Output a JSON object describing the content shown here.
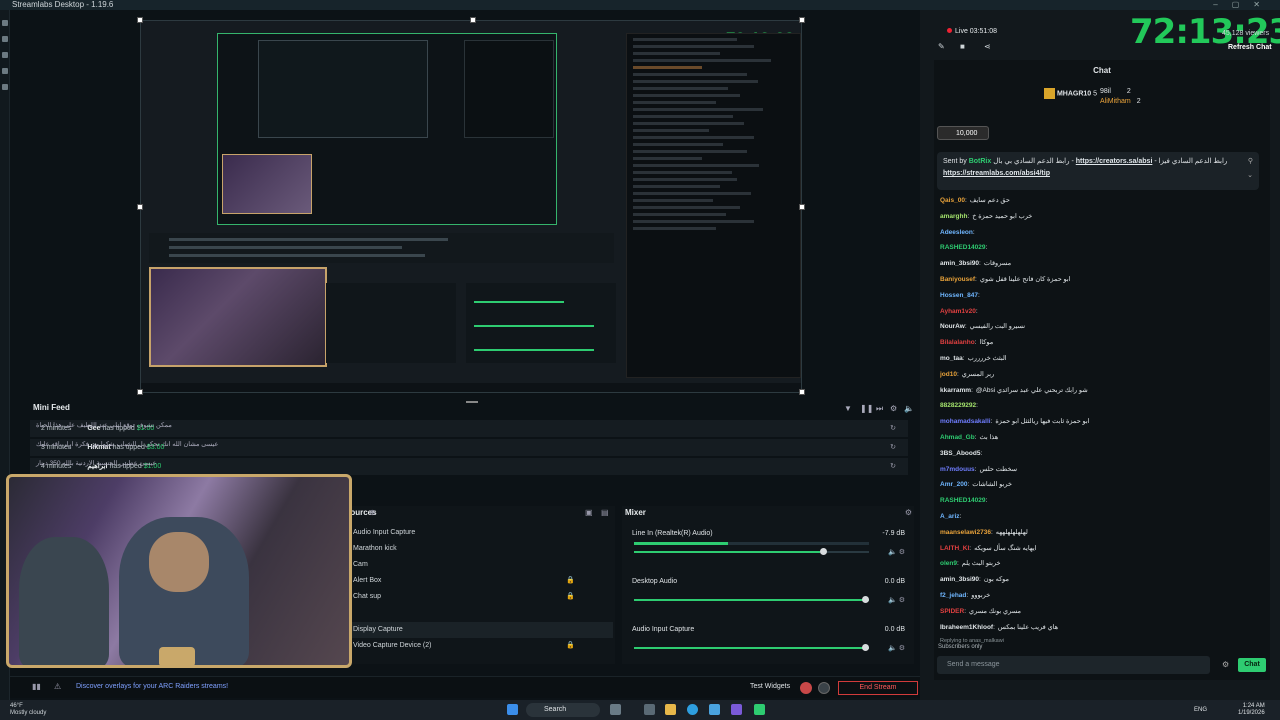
{
  "app": {
    "title": "Streamlabs Desktop - 1.19.6"
  },
  "preview": {
    "clock": "72:13:23"
  },
  "mini_feed": {
    "title": "Mini Feed",
    "rows": [
      {
        "time": "2 minutes",
        "name": "Gee",
        "action": "has tipped",
        "amount": "$1.00",
        "message": "ممكن تشوف توقع ليلى عبد اللطيف على هذا الحياة"
      },
      {
        "time": "3 minutes",
        "name": "Hikmat",
        "action": "has tipped",
        "amount": "$3.00",
        "message": "عيسى مشان الله انك تحكي ل الشباب يفكوا من فكرة ارار باقه عليك"
      },
      {
        "time": "4 minutes",
        "name": "ابراهيم",
        "action": "has tipped",
        "amount": "$1.00",
        "message": "عيسى عطيني الجنسية الاردنية بالله 350 دينار"
      }
    ]
  },
  "sources": {
    "title": "Sources",
    "items": [
      "Audio Input Capture",
      "Marathon kick",
      "Cam",
      "Alert Box",
      "Chat sup",
      "",
      "Display Capture",
      "Video Capture Device (2)"
    ]
  },
  "mixer": {
    "title": "Mixer",
    "channels": [
      {
        "name": "Line In (Realtek(R) Audio)",
        "db": "-7.9 dB",
        "level": 0.85
      },
      {
        "name": "Desktop Audio",
        "db": "0.0 dB",
        "level": 1.0
      },
      {
        "name": "Audio Input Capture",
        "db": "0.0 dB",
        "level": 1.0
      }
    ]
  },
  "footer": {
    "promo": "Discover overlays for your ARC Raiders streams!",
    "test_widgets": "Test Widgets",
    "end_stream": "End Stream"
  },
  "stream": {
    "live": "Live 03:51:08",
    "clock": "72:13:23",
    "viewers": "45,128 viewers",
    "refresh": "Refresh Chat"
  },
  "chat": {
    "title": "Chat",
    "leaders": [
      {
        "name": "MHAGR10",
        "value": "5"
      },
      {
        "name": "98il",
        "value": "2"
      },
      {
        "name": "AliMitham",
        "value": "2"
      }
    ],
    "tip_amount": "10,000",
    "pinned": {
      "sent_by": "Sent by",
      "bot": "BotRix",
      "text": "رابط الدعم السادي بي بال -",
      "link1": "https://creators.sa/absi",
      "text2": "- رابط الدعم السادي فيزا",
      "link2": "https://streamlabs.com/absi4/tip"
    },
    "messages": [
      {
        "user": "Qais_00",
        "color": "#e8a23a",
        "text": "حق دعم سايف"
      },
      {
        "user": "amarghh",
        "color": "#a3e26c",
        "text": "خرب ابو حميد حمزة خ"
      },
      {
        "user": "Adeesleon",
        "color": "#6fb6ff",
        "text": ""
      },
      {
        "user": "RASHED14029",
        "color": "#2ecc71",
        "text": ""
      },
      {
        "user": "amin_3bsi90",
        "color": "#e0e5e8",
        "text": "مسروقات"
      },
      {
        "user": "Baniyousef",
        "color": "#e8a23a",
        "text": "ابو حمزة كان فاتح علينا قفل شوي"
      },
      {
        "user": "Hossen_847",
        "color": "#6fb6ff",
        "text": ""
      },
      {
        "user": "Ayham1v20",
        "color": "#e04040",
        "text": ""
      },
      {
        "user": "NourAw",
        "color": "#e0e5e8",
        "text": "نسيرو البت رالفيسي"
      },
      {
        "user": "Bilalalanho",
        "color": "#e04040",
        "text": "موكاا"
      },
      {
        "user": "mo_taa",
        "color": "#e0e5e8",
        "text": "البثث خررررب"
      },
      {
        "user": "jod10",
        "color": "#e8a23a",
        "text": "ربر المسري"
      },
      {
        "user": "kkarramm",
        "color": "#e0e5e8",
        "text": "@Absi شو رابك تربحني علي عبد سرائدي"
      },
      {
        "user": "8828229292",
        "color": "#a3e26c",
        "text": ""
      },
      {
        "user": "mohamadsakalli",
        "color": "#6f7dff",
        "text": "ابو حمزة ثابت فيها ريالثثل ابو حمزة"
      },
      {
        "user": "Ahmad_Gb",
        "color": "#2ecc71",
        "text": "هذا بث"
      },
      {
        "user": "3BS_Abood5",
        "color": "#e0e5e8",
        "text": ""
      },
      {
        "user": "m7mdouus",
        "color": "#6f7dff",
        "text": "سخطت حلس"
      },
      {
        "user": "Amr_200",
        "color": "#6fb6ff",
        "text": "خربو الشاشات"
      },
      {
        "user": "RASHED14029",
        "color": "#2ecc71",
        "text": ""
      },
      {
        "user": "A_ariz",
        "color": "#6fb6ff",
        "text": ""
      },
      {
        "user": "maanselawi2736",
        "color": "#e8a23a",
        "text": "لهلهلهلهلههه"
      },
      {
        "user": "LAITH_KI",
        "color": "#e04040",
        "text": "ايهايه شنگ سأل سويكه"
      },
      {
        "user": "olen9",
        "color": "#2ecc71",
        "text": "خربتو البث يلم"
      },
      {
        "user": "amin_3bsi90",
        "color": "#e0e5e8",
        "text": "موكه بون"
      },
      {
        "user": "f2_jehad",
        "color": "#6fb6ff",
        "text": "خربووو"
      },
      {
        "user": "SPIDER",
        "color": "#e04040",
        "text": "مسري بونك مسري"
      },
      {
        "user": "Ibraheem1Khloof",
        "color": "#e0e5e8",
        "text": "هاي فريب علينا بمكس"
      }
    ],
    "reply_note": "Replying to anas_malkawi",
    "subscribers_only": "Subscribers only",
    "send_placeholder": "Send a message",
    "chat_button": "Chat"
  },
  "taskbar": {
    "weather_temp": "46°F",
    "weather_desc": "Mostly cloudy",
    "search": "Search",
    "lang": "ENG",
    "time": "1:24 AM",
    "date": "1/19/2026"
  }
}
